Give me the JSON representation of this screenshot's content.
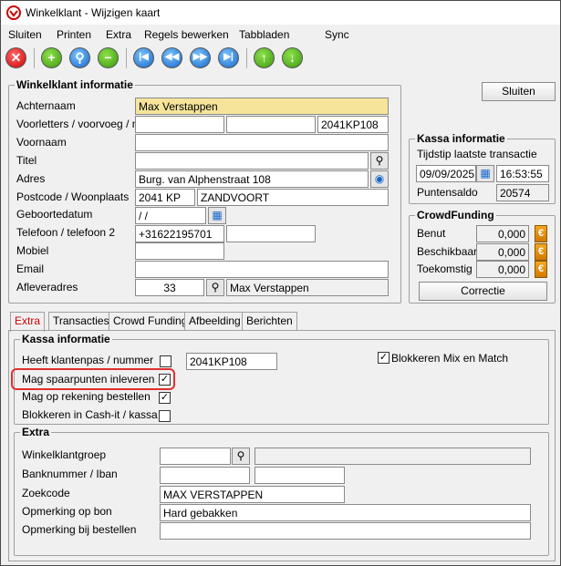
{
  "window": {
    "title": "Winkelklant - Wijzigen kaart"
  },
  "menu": [
    "Sluiten",
    "Printen",
    "Extra",
    "Regels bewerken",
    "Tabbladen",
    "Sync"
  ],
  "toolbar": {
    "icons": [
      "close-icon",
      "add-icon",
      "search-icon",
      "remove-icon",
      "first-icon",
      "previous-icon",
      "next-icon",
      "last-icon",
      "up-icon",
      "down-icon"
    ],
    "colors": {
      "red": "#d20000",
      "green": "#3a9a10",
      "blue": "#1466c8"
    }
  },
  "customer": {
    "section_title": "Winkelklant informatie",
    "achternaam_label": "Achternaam",
    "achternaam": "Max Verstappen",
    "voorletters_label": "Voorletters / voorvoeg / nr",
    "voorletters": "",
    "voorvoeg": "",
    "nr": "2041KP108",
    "voornaam_label": "Voornaam",
    "voornaam": "",
    "titel_label": "Titel",
    "titel": "",
    "adres_label": "Adres",
    "adres": "Burg. van Alphenstraat 108",
    "postcode_label": "Postcode / Woonplaats",
    "postcode": "2041 KP",
    "woonplaats": "ZANDVOORT",
    "geboortedatum_label": "Geboortedatum",
    "geboortedatum": " /  /",
    "telefoon_label": "Telefoon / telefoon 2",
    "telefoon": "+31622195701",
    "telefoon2": "",
    "mobiel_label": "Mobiel",
    "mobiel": "",
    "email_label": "Email",
    "email": "",
    "afleveradres_label": "Afleveradres",
    "afleveradres_nr": "33",
    "afleveradres_naam": "Max Verstappen"
  },
  "close_button": "Sluiten",
  "kassa": {
    "title": "Kassa informatie",
    "tijdstip_label": "Tijdstip laatste transactie",
    "date": "09/09/2025",
    "time": "16:53:55",
    "puntensaldo_label": "Puntensaldo",
    "puntensaldo": "20574"
  },
  "crowdfunding": {
    "title": "CrowdFunding",
    "benut_label": "Benut",
    "benut": "0,000",
    "beschikbaar_label": "Beschikbaar",
    "beschikbaar": "0,000",
    "toekomstig_label": "Toekomstig",
    "toekomstig": "0,000",
    "correctie": "Correctie"
  },
  "tabs": [
    "Extra",
    "Transacties",
    "Crowd Funding",
    "Afbeelding",
    "Berichten"
  ],
  "extra": {
    "kassa_title": "Kassa informatie",
    "klantenpas_label": "Heeft klantenpas / nummer",
    "klantenpas_checked": "",
    "klantenpas_nummer": "2041KP108",
    "blokkeren_mix_label": "Blokkeren Mix en Match",
    "blokkeren_mix_checked": "✓",
    "spaarpunten_label": "Mag spaarpunten inleveren",
    "spaarpunten_checked": "✓",
    "rekening_label": "Mag op rekening bestellen",
    "rekening_checked": "✓",
    "cashit_label": "Blokkeren in Cash-it / kassa",
    "cashit_checked": "",
    "highlight_color": "#e03030",
    "extra_title": "Extra",
    "winkelklantgroep_label": "Winkelklantgroep",
    "winkelklantgroep": "",
    "winkelklantgroep_desc": "",
    "banknummer_label": "Banknummer / Iban",
    "banknummer": "",
    "iban": "",
    "zoekcode_label": "Zoekcode",
    "zoekcode": "MAX VERSTAPPEN",
    "opmerking_bon_label": "Opmerking op bon",
    "opmerking_bon": "Hard gebakken",
    "opmerking_bestellen_label": "Opmerking bij bestellen",
    "opmerking_bestellen": ""
  }
}
